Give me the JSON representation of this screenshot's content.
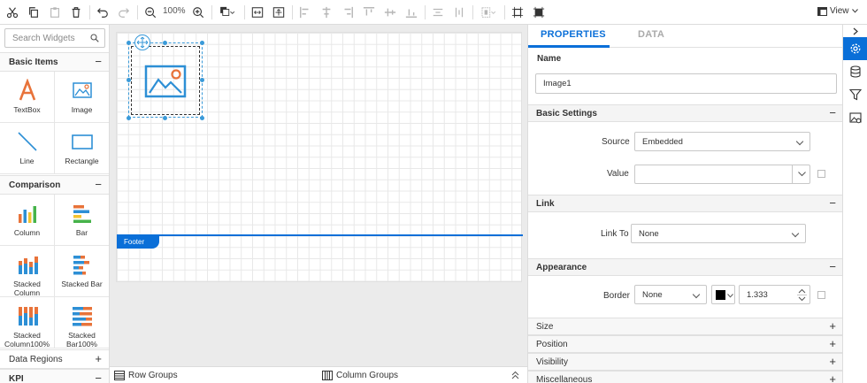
{
  "toolbar": {
    "zoom": "100%",
    "view_label": "View"
  },
  "widgets": {
    "search_placeholder": "Search Widgets",
    "categories": [
      {
        "label": "Basic Items",
        "toggle": "−"
      },
      {
        "label": "Comparison",
        "toggle": "−"
      },
      {
        "label": "Data Regions",
        "toggle": "+"
      },
      {
        "label": "KPI",
        "toggle": "−"
      }
    ],
    "basic_items": [
      "TextBox",
      "Image",
      "Line",
      "Rectangle"
    ],
    "comparison": [
      "Column",
      "Bar",
      "Stacked Column",
      "Stacked Bar",
      "Stacked Column100%",
      "Stacked Bar100%"
    ]
  },
  "design": {
    "footer_label": "Footer"
  },
  "groups": {
    "row": "Row Groups",
    "column": "Column Groups"
  },
  "properties": {
    "tabs": [
      "PROPERTIES",
      "DATA"
    ],
    "name_label": "Name",
    "name_value": "Image1",
    "sections": {
      "basic": "Basic Settings",
      "link": "Link",
      "appearance": "Appearance",
      "size": "Size",
      "position": "Position",
      "visibility": "Visibility",
      "misc": "Miscellaneous"
    },
    "source_label": "Source",
    "source_value": "Embedded",
    "value_label": "Value",
    "value_value": "",
    "link_to_label": "Link To",
    "link_to_value": "None",
    "border_label": "Border",
    "border_style": "None",
    "border_width": "1.333",
    "border_color": "#000000"
  },
  "colors": {
    "accent": "#0a6fd8"
  }
}
